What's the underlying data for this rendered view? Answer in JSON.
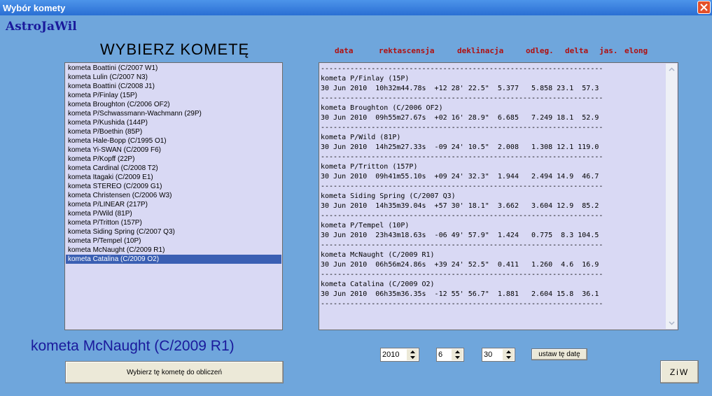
{
  "window": {
    "title": "Wybór komety"
  },
  "brand": "AstroJaWil",
  "heading": "WYBIERZ KOMETĘ",
  "columns": [
    "data",
    "rektascensja",
    "deklinacja",
    "odleg.",
    "delta",
    "jas.",
    "elong"
  ],
  "comet_list": {
    "selected_index": 21,
    "items": [
      "kometa Boattini (C/2007 W1)",
      "kometa Lulin (C/2007 N3)",
      "kometa Boattini (C/2008 J1)",
      "kometa P/Finlay (15P)",
      "kometa Broughton (C/2006 OF2)",
      "kometa P/Schwassmann-Wachmann (29P)",
      "kometa P/Kushida (144P)",
      "kometa P/Boethin (85P)",
      "kometa Hale-Bopp (C/1995 O1)",
      "kometa Yi-SWAN (C/2009 F6)",
      "kometa P/Kopff (22P)",
      "kometa Cardinal (C/2008 T2)",
      "kometa Itagaki (C/2009 E1)",
      "kometa STEREO (C/2009 G1)",
      "kometa Christensen (C/2006 W3)",
      "kometa P/LINEAR (217P)",
      "kometa P/Wild (81P)",
      "kometa P/Tritton (157P)",
      "kometa Siding Spring (C/2007 Q3)",
      "kometa P/Tempel (10P)",
      "kometa McNaught (C/2009 R1)",
      "kometa Catalina (C/2009 O2)"
    ]
  },
  "results": {
    "separator": "-------------------------------------------------------------------",
    "entries": [
      {
        "name": "kometa P/Finlay (15P)",
        "row": "30 Jun 2010  10h32m44.78s  +12 28' 22.5\"  5.377   5.858 23.1  57.3"
      },
      {
        "name": "kometa Broughton (C/2006 OF2)",
        "row": "30 Jun 2010  09h55m27.67s  +02 16' 28.9\"  6.685   7.249 18.1  52.9"
      },
      {
        "name": "kometa P/Wild (81P)",
        "row": "30 Jun 2010  14h25m27.33s  -09 24' 10.5\"  2.008   1.308 12.1 119.0"
      },
      {
        "name": "kometa P/Tritton (157P)",
        "row": "30 Jun 2010  09h41m55.10s  +09 24' 32.3\"  1.944   2.494 14.9  46.7"
      },
      {
        "name": "kometa Siding Spring (C/2007 Q3)",
        "row": "30 Jun 2010  14h35m39.04s  +57 30' 18.1\"  3.662   3.604 12.9  85.2"
      },
      {
        "name": "kometa P/Tempel (10P)",
        "row": "30 Jun 2010  23h43m18.63s  -06 49' 57.9\"  1.424   0.775  8.3 104.5"
      },
      {
        "name": "kometa McNaught (C/2009 R1)",
        "row": "30 Jun 2010  06h56m24.86s  +39 24' 52.5\"  0.411   1.260  4.6  16.9"
      },
      {
        "name": "kometa Catalina (C/2009 O2)",
        "row": "30 Jun 2010  06h35m36.35s  -12 55' 56.7\"  1.881   2.604 15.8  36.1"
      }
    ]
  },
  "selected_comet": "kometa McNaught (C/2009 R1)",
  "buttons": {
    "choose": "Wybierz tę kometę do obliczeń",
    "set_date": "ustaw tę datę",
    "ziw": "ZiW"
  },
  "date": {
    "year": "2010",
    "month": "6",
    "day": "30"
  },
  "colors": {
    "background": "#6fa6dc",
    "accent": "#1a1a9c",
    "header_red": "#b01010",
    "selection": "#3a5fb3"
  }
}
